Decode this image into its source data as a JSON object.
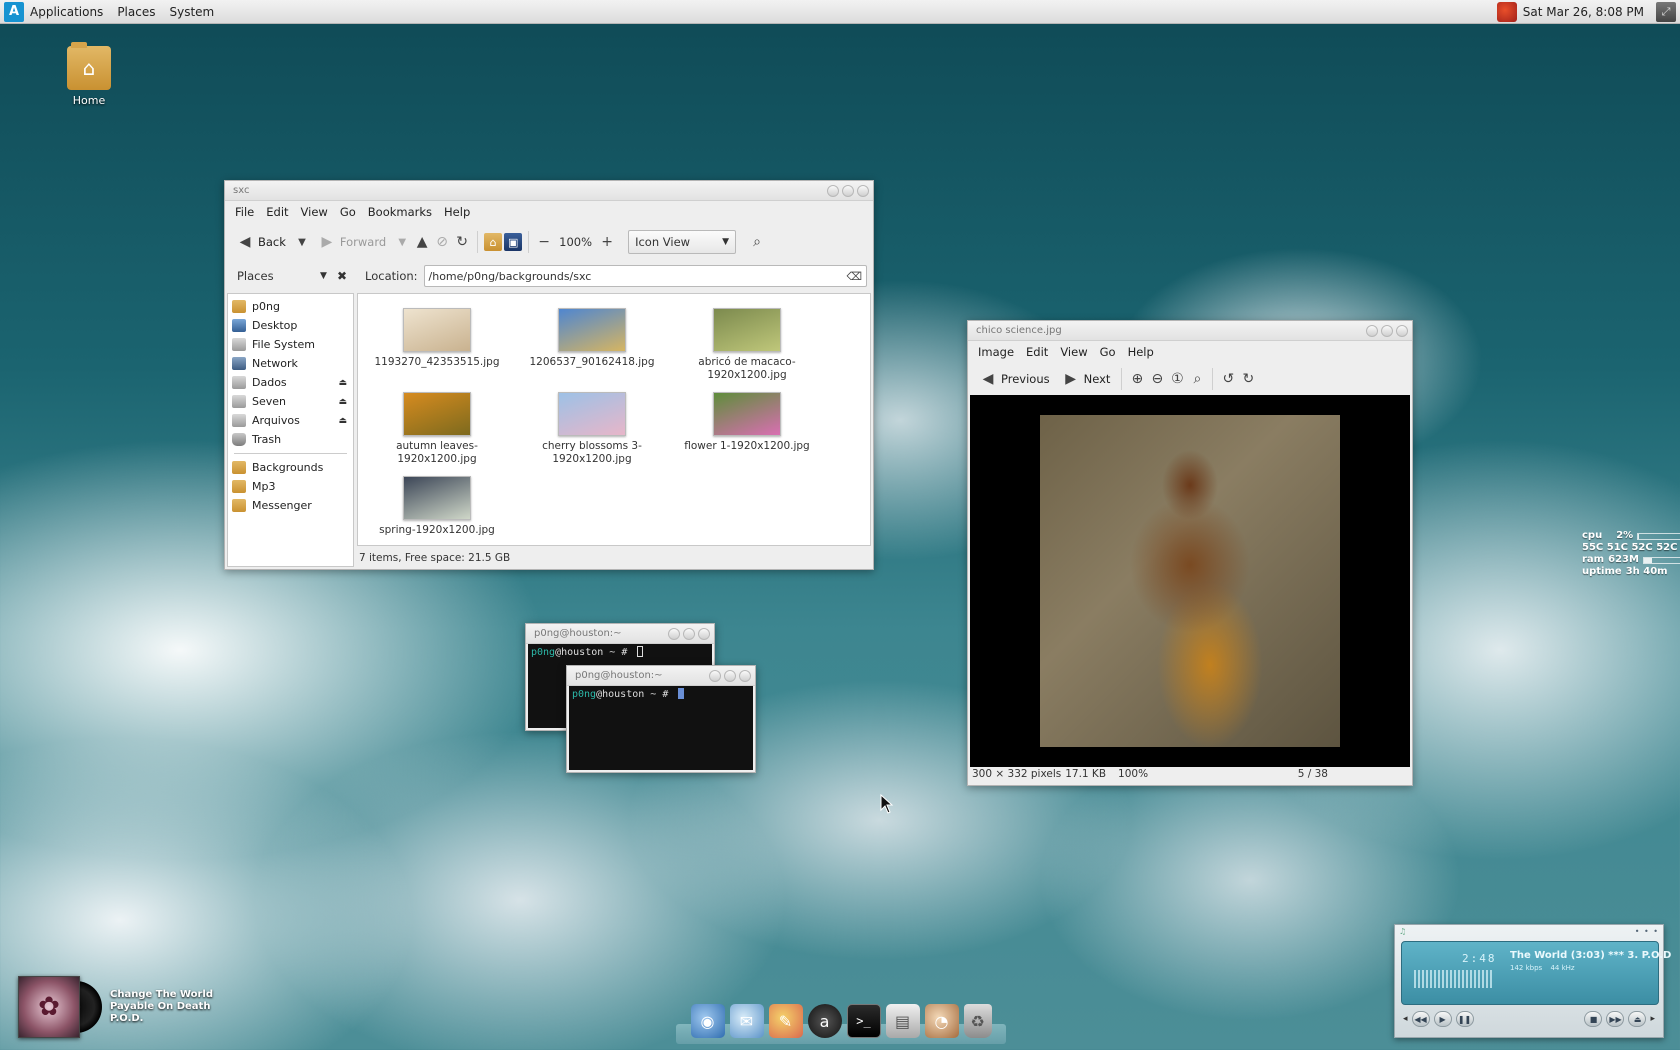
{
  "top_panel": {
    "menus": [
      "Applications",
      "Places",
      "System"
    ],
    "clock": "Sat Mar 26,  8:08 PM"
  },
  "desktop": {
    "home_label": "Home"
  },
  "file_manager": {
    "title": "sxc",
    "menus": [
      "File",
      "Edit",
      "View",
      "Go",
      "Bookmarks",
      "Help"
    ],
    "back_label": "Back",
    "forward_label": "Forward",
    "zoom": "100%",
    "view_mode": "Icon View",
    "places_label": "Places",
    "location_label": "Location:",
    "location_value": "/home/p0ng/backgrounds/sxc",
    "sidebar": [
      {
        "label": "p0ng",
        "icon": "home-icon"
      },
      {
        "label": "Desktop",
        "icon": "desktop-icon"
      },
      {
        "label": "File System",
        "icon": "drive-icon"
      },
      {
        "label": "Network",
        "icon": "network-icon"
      },
      {
        "label": "Dados",
        "icon": "drive-icon",
        "eject": true
      },
      {
        "label": "Seven",
        "icon": "drive-icon",
        "eject": true
      },
      {
        "label": "Arquivos",
        "icon": "drive-icon",
        "eject": true
      },
      {
        "label": "Trash",
        "icon": "trash-icon"
      }
    ],
    "bookmarks": [
      "Backgrounds",
      "Mp3",
      "Messenger"
    ],
    "files": [
      {
        "name": "1193270_42353515.jpg",
        "colors": [
          "#eee3cf",
          "#c9b28f"
        ]
      },
      {
        "name": "1206537_90162418.jpg",
        "colors": [
          "#4f86d0",
          "#d6b562"
        ]
      },
      {
        "name": "abricó de macaco-1920x1200.jpg",
        "colors": [
          "#7c8a4e",
          "#bfc77a"
        ]
      },
      {
        "name": "autumn leaves-1920x1200.jpg",
        "colors": [
          "#d68b1f",
          "#7d6a1e"
        ]
      },
      {
        "name": "cherry blossoms 3-1920x1200.jpg",
        "colors": [
          "#9dc1e6",
          "#e7b6c9"
        ]
      },
      {
        "name": "flower 1-1920x1200.jpg",
        "colors": [
          "#5e8d3a",
          "#d96fb2"
        ]
      },
      {
        "name": "spring-1920x1200.jpg",
        "colors": [
          "#3c4657",
          "#cfd7c8"
        ]
      }
    ],
    "status": "7 items, Free space: 21.5 GB"
  },
  "image_viewer": {
    "title": "chico science.jpg",
    "menus": [
      "Image",
      "Edit",
      "View",
      "Go",
      "Help"
    ],
    "previous_label": "Previous",
    "next_label": "Next",
    "dimensions": "300 × 332 pixels",
    "size": "17.1 KB",
    "zoom": "100%",
    "position": "5 / 38"
  },
  "terminals": [
    {
      "title": "p0ng@houston:~",
      "user": "p0ng",
      "at": "@",
      "host": "houston",
      "path": " ~ # "
    },
    {
      "title": "p0ng@houston:~",
      "user": "p0ng",
      "at": "@",
      "host": "houston",
      "path": " ~ # "
    }
  ],
  "conky": {
    "cpu_label": "cpu",
    "cpu_value": "2%",
    "cpu_fraction": 0.02,
    "temps": "55C 51C 52C 52C",
    "ram_label": "ram",
    "ram_value": "623M",
    "ram_fraction": 0.2,
    "uptime_label": "uptime",
    "uptime_value": "3h 40m"
  },
  "now_playing": {
    "title": "Change The World",
    "album": "Payable On Death",
    "artist": "P.O.D."
  },
  "player": {
    "time": "2:48",
    "track": "The World (3:03) *** 3. P.O.D",
    "bitrate": "142",
    "bitrate_unit": "kbps",
    "samplerate": "44",
    "samplerate_unit": "kHz"
  },
  "colors": {
    "terminal_user": "#2cb8a8",
    "arch_blue": "#1793d1"
  }
}
